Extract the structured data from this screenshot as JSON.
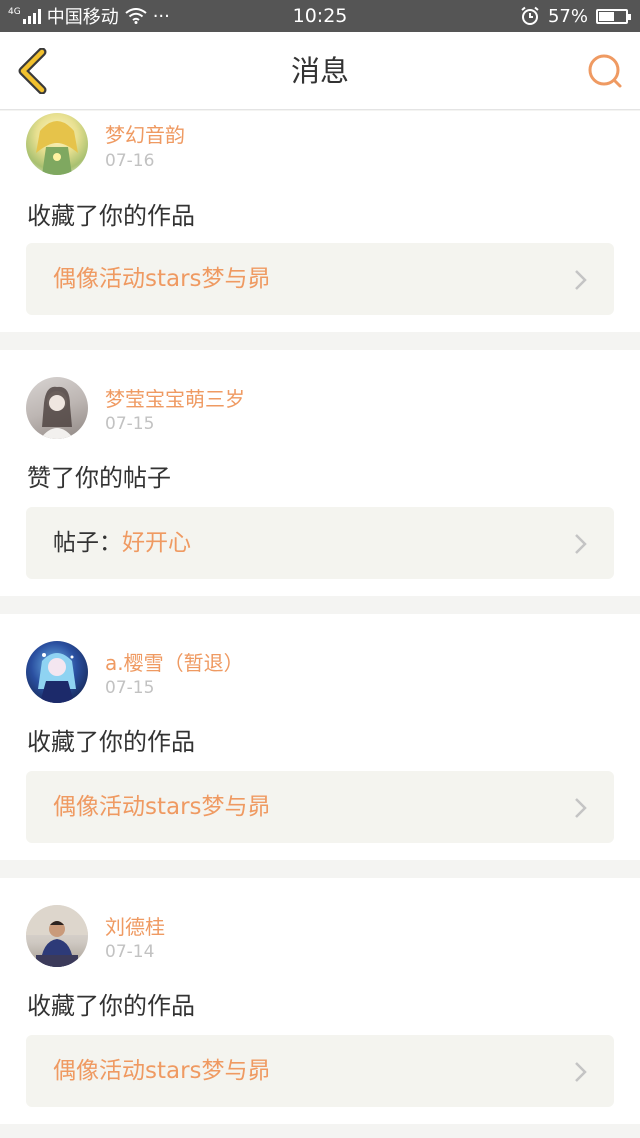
{
  "status_bar": {
    "network": "4G",
    "carrier": "中国移动",
    "more": "···",
    "time": "10:25",
    "battery": "57%",
    "battery_level": 0.57
  },
  "header": {
    "title": "消息"
  },
  "messages": [
    {
      "user": "梦幻音韵",
      "date": "07-16",
      "action": "收藏了你的作品",
      "ref_label": "",
      "ref_value": "偶像活动stars梦与昴"
    },
    {
      "user": "梦莹宝宝萌三岁",
      "date": "07-15",
      "action": "赞了你的帖子",
      "ref_label": "帖子：",
      "ref_value": "好开心"
    },
    {
      "user": "a.樱雪（暂退）",
      "date": "07-15",
      "action": "收藏了你的作品",
      "ref_label": "",
      "ref_value": "偶像活动stars梦与昴"
    },
    {
      "user": "刘德桂",
      "date": "07-14",
      "action": "收藏了你的作品",
      "ref_label": "",
      "ref_value": "偶像活动stars梦与昴"
    }
  ],
  "colors": {
    "accent": "#ef9a62",
    "back_icon": "#f2c12e",
    "status_bar": "#555555"
  },
  "icons": [
    "back-arrow-icon",
    "search-icon",
    "chevron-right-icon",
    "wifi-icon",
    "alarm-icon",
    "battery-icon"
  ]
}
